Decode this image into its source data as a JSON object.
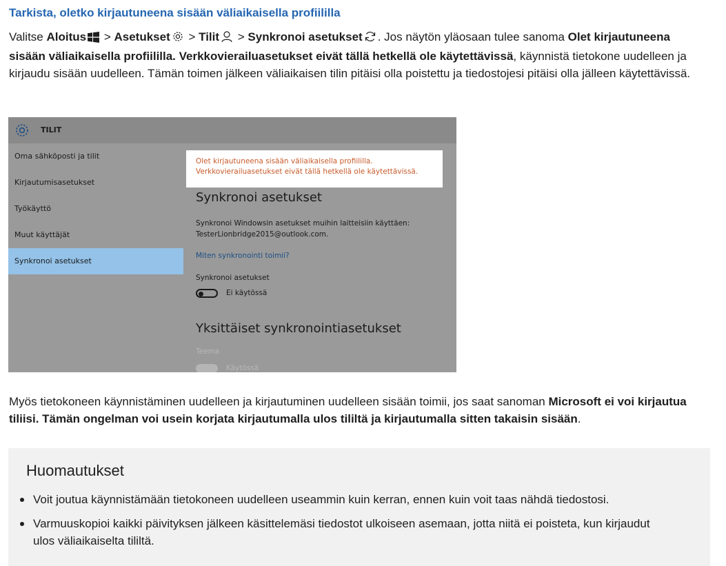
{
  "heading": "Tarkista, oletko kirjautuneena sisään väliaikaisella profiililla",
  "para1": {
    "t1": "Valitse ",
    "start": "Aloitus",
    "sep1": " > ",
    "settings": "Asetukset",
    "sep2": " > ",
    "accounts": "Tilit",
    "sep3": " > ",
    "sync": "Synkronoi asetukset",
    "t2": ". Jos näytön yläosaan tulee sanoma ",
    "message": "Olet kirjautuneena sisään väliaikaisella profiililla. Verkkovierailuasetukset eivät tällä hetkellä ole käytettävissä",
    "t3": ", käynnistä tietokone uudelleen ja kirjaudu sisään uudelleen. Tämän toimen jälkeen väliaikaisen tilin pitäisi olla poistettu ja tiedostojesi pitäisi olla jälleen käytettävissä."
  },
  "screenshot": {
    "title": "TILIT",
    "nav": [
      "Oma sähköposti ja tilit",
      "Kirjautumisasetukset",
      "Työkäyttö",
      "Muut käyttäjät",
      "Synkronoi asetukset"
    ],
    "active_index": 4,
    "warning_line1": "Olet kirjautuneena sisään väliaikaisella profiililla.",
    "warning_line2": "Verkkovierailuasetukset eivät tällä hetkellä ole käytettävissä.",
    "section_title": "Synkronoi asetukset",
    "description_line1": "Synkronoi Windowsin asetukset muihin laitteisiin käyttäen:",
    "description_line2": "TesterLionbridge2015@outlook.com.",
    "link": "Miten synkronointi toimii?",
    "sync_label": "Synkronoi asetukset",
    "sync_toggle_label": "Ei käytössä",
    "section2_title": "Yksittäiset synkronointiasetukset",
    "theme_label": "Teema",
    "theme_toggle_label": "Käytössä"
  },
  "para2": {
    "t1": "Myös tietokoneen käynnistäminen uudelleen ja kirjautuminen uudelleen sisään toimii, jos saat sanoman ",
    "message": "Microsoft ei voi kirjautua tiliisi. Tämän ongelman voi usein korjata kirjautumalla ulos tililtä ja kirjautumalla sitten takaisin sisään",
    "t2": "."
  },
  "notes": {
    "title": "Huomautukset",
    "items": [
      "Voit joutua käynnistämään tietokoneen uudelleen useammin kuin kerran, ennen kuin voit taas nähdä tiedostosi.",
      "Varmuuskopioi kaikki päivityksen jälkeen käsittelemäsi tiedostot ulkoiseen asemaan, jotta niitä ei poisteta, kun kirjaudut ulos väliaikaiselta tililtä."
    ]
  }
}
